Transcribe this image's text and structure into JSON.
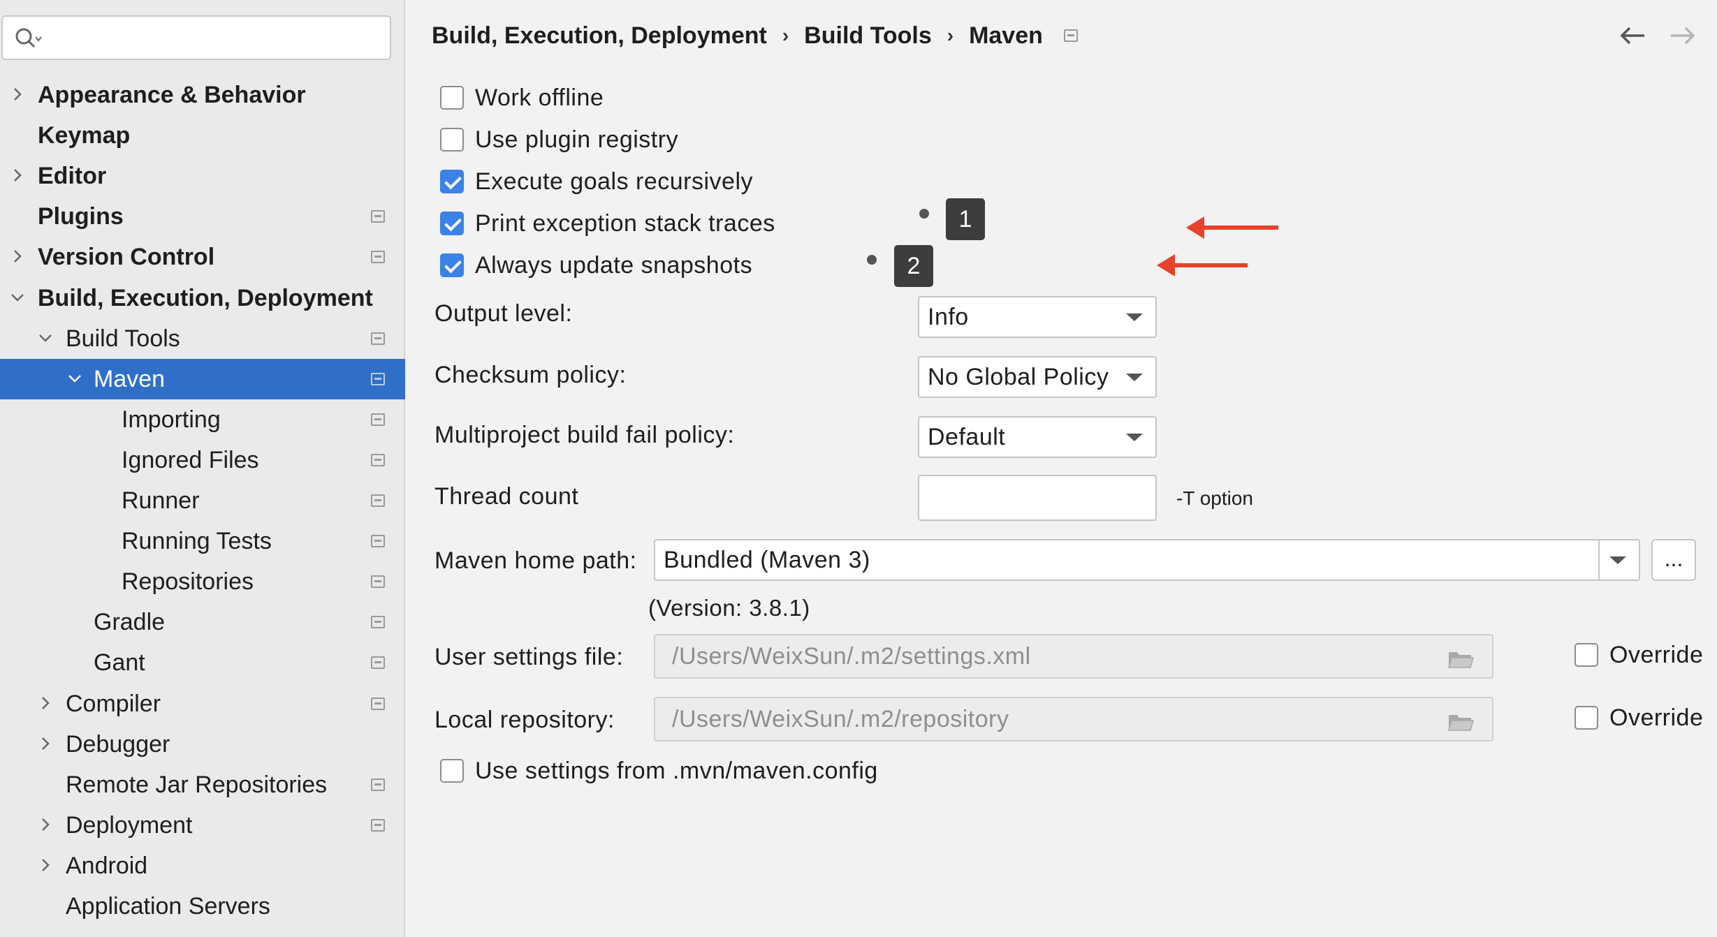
{
  "sidebar": {
    "search_placeholder": "",
    "items": [
      {
        "label": "Appearance & Behavior",
        "bold": true,
        "chevron": "right",
        "indent": 0,
        "project_icon": false
      },
      {
        "label": "Keymap",
        "bold": true,
        "chevron": "none",
        "indent": 0,
        "project_icon": false
      },
      {
        "label": "Editor",
        "bold": true,
        "chevron": "right",
        "indent": 0,
        "project_icon": false
      },
      {
        "label": "Plugins",
        "bold": true,
        "chevron": "none",
        "indent": 0,
        "project_icon": true
      },
      {
        "label": "Version Control",
        "bold": true,
        "chevron": "right",
        "indent": 0,
        "project_icon": true
      },
      {
        "label": "Build, Execution, Deployment",
        "bold": true,
        "chevron": "down",
        "indent": 0,
        "project_icon": false
      },
      {
        "label": "Build Tools",
        "bold": false,
        "chevron": "down",
        "indent": 1,
        "project_icon": true
      },
      {
        "label": "Maven",
        "bold": false,
        "chevron": "down",
        "indent": 2,
        "project_icon": true,
        "selected": true
      },
      {
        "label": "Importing",
        "bold": false,
        "chevron": "none",
        "indent": 3,
        "project_icon": true
      },
      {
        "label": "Ignored Files",
        "bold": false,
        "chevron": "none",
        "indent": 3,
        "project_icon": true
      },
      {
        "label": "Runner",
        "bold": false,
        "chevron": "none",
        "indent": 3,
        "project_icon": true
      },
      {
        "label": "Running Tests",
        "bold": false,
        "chevron": "none",
        "indent": 3,
        "project_icon": true
      },
      {
        "label": "Repositories",
        "bold": false,
        "chevron": "none",
        "indent": 3,
        "project_icon": true
      },
      {
        "label": "Gradle",
        "bold": false,
        "chevron": "none",
        "indent": 2,
        "project_icon": true
      },
      {
        "label": "Gant",
        "bold": false,
        "chevron": "none",
        "indent": 2,
        "project_icon": true
      },
      {
        "label": "Compiler",
        "bold": false,
        "chevron": "right",
        "indent": 1,
        "project_icon": true
      },
      {
        "label": "Debugger",
        "bold": false,
        "chevron": "right",
        "indent": 1,
        "project_icon": false
      },
      {
        "label": "Remote Jar Repositories",
        "bold": false,
        "chevron": "none",
        "indent": 1,
        "project_icon": true
      },
      {
        "label": "Deployment",
        "bold": false,
        "chevron": "right",
        "indent": 1,
        "project_icon": true
      },
      {
        "label": "Android",
        "bold": false,
        "chevron": "right",
        "indent": 1,
        "project_icon": false
      },
      {
        "label": "Application Servers",
        "bold": false,
        "chevron": "none",
        "indent": 1,
        "project_icon": false
      }
    ]
  },
  "breadcrumb": {
    "items": [
      "Build, Execution, Deployment",
      "Build Tools",
      "Maven"
    ],
    "separator": "›"
  },
  "checkboxes": {
    "work_offline": {
      "label": "Work offline",
      "checked": false
    },
    "use_plugin_registry": {
      "label": "Use plugin registry",
      "checked": false
    },
    "execute_goals_recursively": {
      "label": "Execute goals recursively",
      "checked": true
    },
    "print_exception_stack_traces": {
      "label": "Print exception stack traces",
      "checked": true
    },
    "always_update_snapshots": {
      "label": "Always update snapshots",
      "checked": true
    },
    "use_settings_from_mvn": {
      "label": "Use settings from .mvn/maven.config",
      "checked": false
    }
  },
  "fields": {
    "output_level": {
      "label": "Output level:",
      "value": "Info"
    },
    "checksum_policy": {
      "label": "Checksum policy:",
      "value": "No Global Policy"
    },
    "multiproject_fail_policy": {
      "label": "Multiproject build fail policy:",
      "value": "Default"
    },
    "thread_count": {
      "label": "Thread count",
      "value": "",
      "hint": "-T option"
    },
    "maven_home_path": {
      "label": "Maven home path:",
      "value": "Bundled (Maven 3)",
      "browse": "...",
      "version": "(Version: 3.8.1)"
    },
    "user_settings_file": {
      "label": "User settings file:",
      "value": "/Users/WeixSun/.m2/settings.xml",
      "override": "Override"
    },
    "local_repository": {
      "label": "Local repository:",
      "value": "/Users/WeixSun/.m2/repository",
      "override": "Override"
    }
  },
  "annotations": [
    {
      "number": "1",
      "color": "#e8412c"
    },
    {
      "number": "2",
      "color": "#e8412c"
    }
  ],
  "colors": {
    "selection": "#2f6fc7",
    "checkbox_checked": "#3b82e6",
    "annotation_arrow": "#e8412c"
  }
}
